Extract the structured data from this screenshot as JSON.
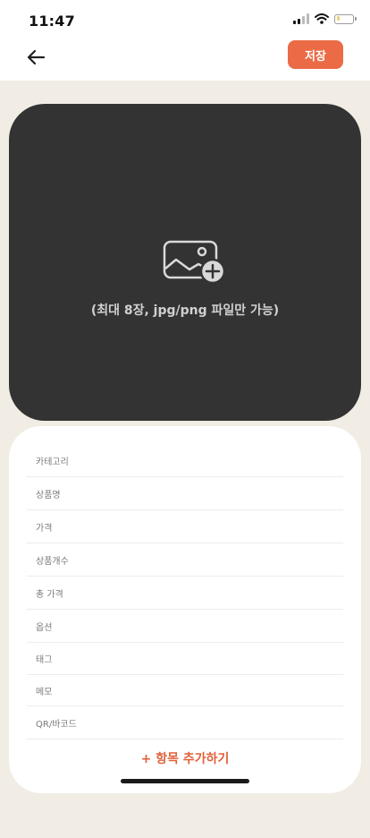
{
  "status_bar": {
    "time": "11:47"
  },
  "header": {
    "save_label": "저장"
  },
  "upload": {
    "hint": "(최대 8장, jpg/png 파일만 가능)"
  },
  "form": {
    "fields": [
      "카테고리",
      "상품명",
      "가격",
      "상품개수",
      "총 가격",
      "옵션",
      "태그",
      "메모",
      "QR/바코드"
    ],
    "add_label": "+ 항목 추가하기"
  },
  "colors": {
    "accent": "#ea6b45",
    "background": "#f1ede4",
    "upload_bg": "#333333"
  }
}
